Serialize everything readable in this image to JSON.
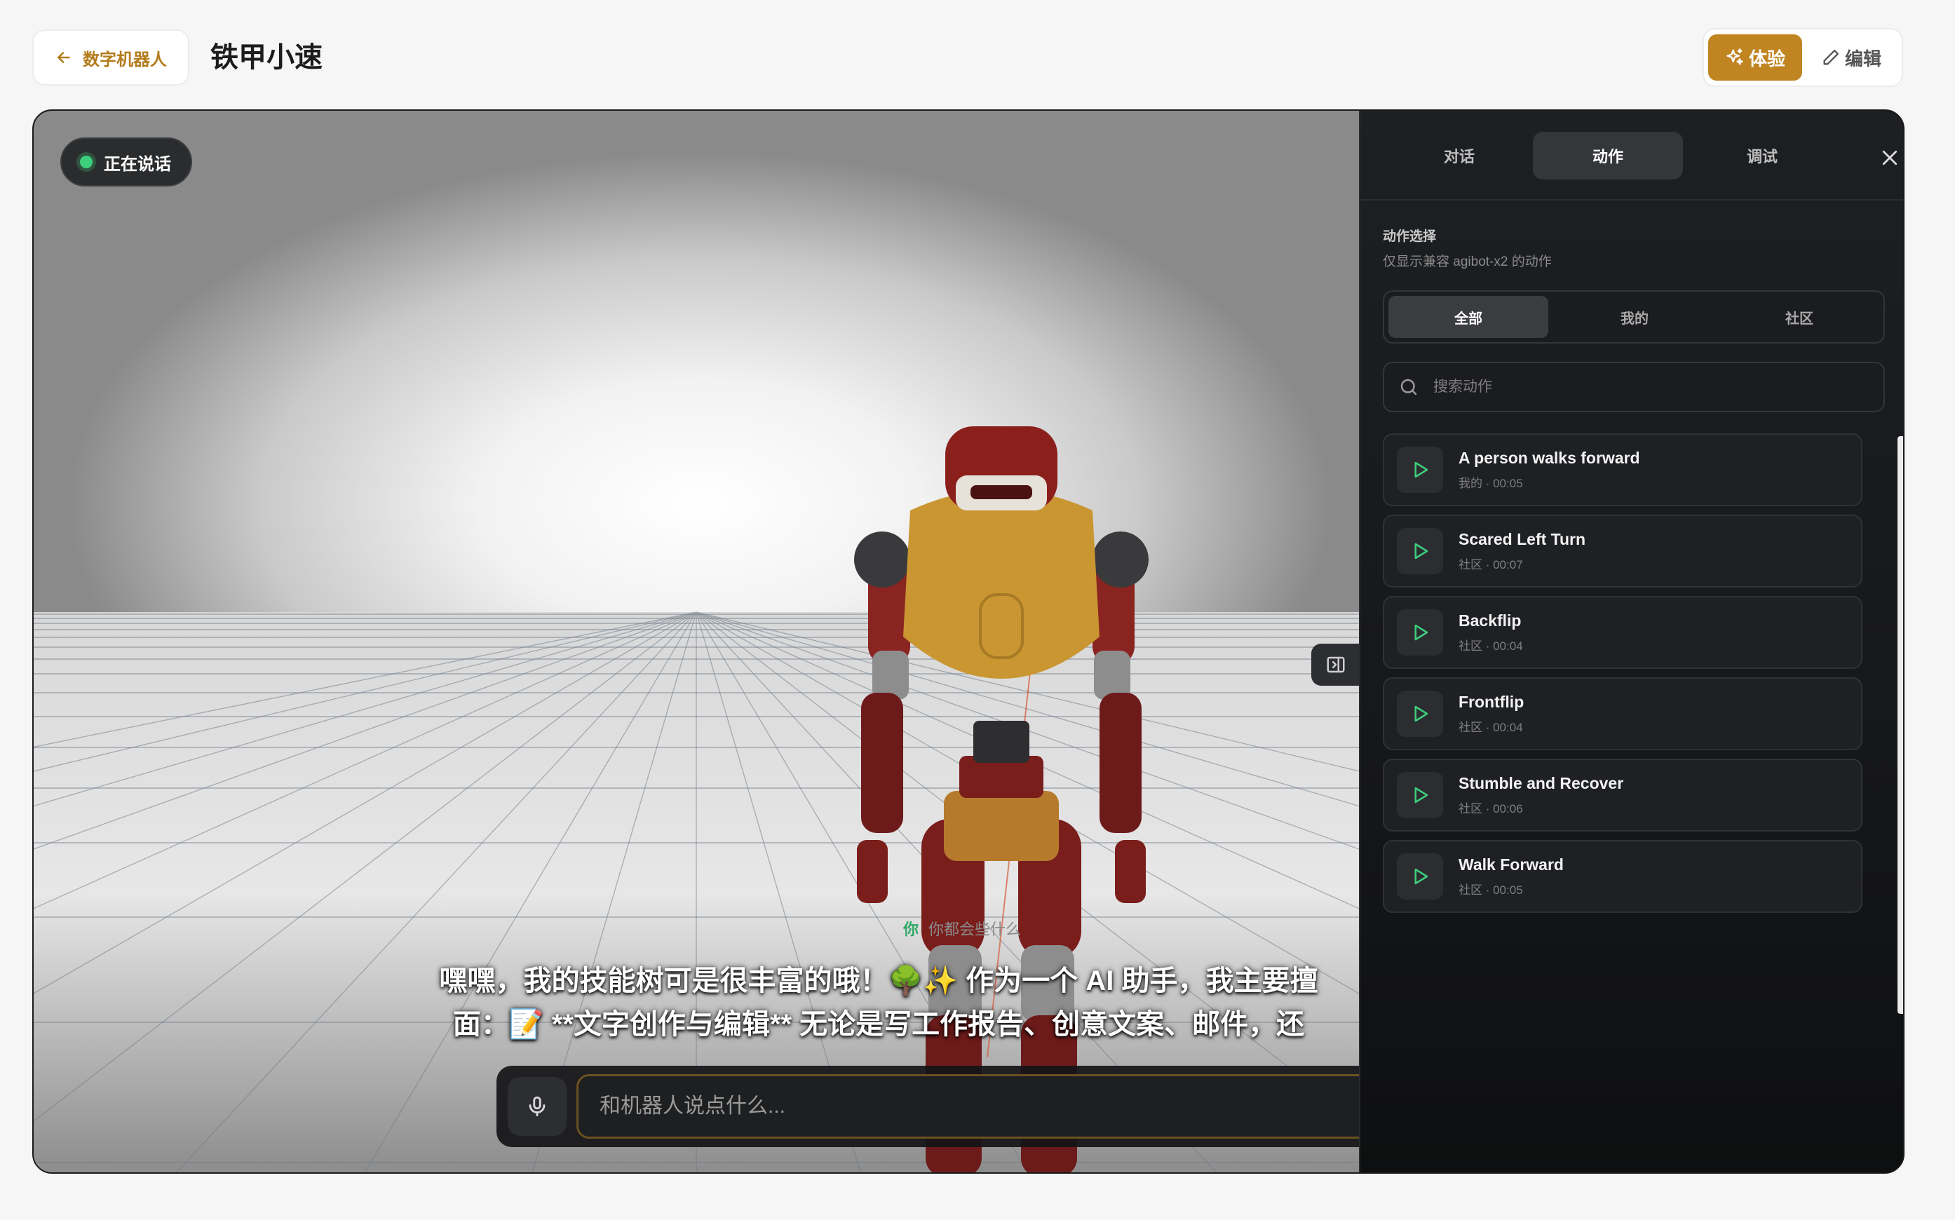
{
  "header": {
    "back_label": "数字机器人",
    "title": "铁甲小速",
    "mode_experience": "体验",
    "mode_edit": "编辑"
  },
  "viewport": {
    "status": "正在说话",
    "user_tag": "你",
    "user_message": "你都会些什么",
    "subtitle_line1": "嘿嘿，我的技能树可是很丰富的哦！🌳✨ 作为一个 AI 助手，我主要擅",
    "subtitle_line2": "面：📝 **文字创作与编辑** 无论是写工作报告、创意文案、邮件，还",
    "input_placeholder": "和机器人说点什么..."
  },
  "panel": {
    "tabs": [
      "对话",
      "动作",
      "调试"
    ],
    "active_tab": "动作",
    "section_title": "动作选择",
    "section_subtitle": "仅显示兼容 agibot-x2 的动作",
    "filters": [
      "全部",
      "我的",
      "社区"
    ],
    "active_filter": "全部",
    "search_placeholder": "搜索动作",
    "motions": [
      {
        "name": "A person walks forward",
        "meta": "我的 · 00:05"
      },
      {
        "name": "Scared Left Turn",
        "meta": "社区 · 00:07"
      },
      {
        "name": "Backflip",
        "meta": "社区 · 00:04"
      },
      {
        "name": "Frontflip",
        "meta": "社区 · 00:04"
      },
      {
        "name": "Stumble and Recover",
        "meta": "社区 · 00:06"
      },
      {
        "name": "Walk Forward",
        "meta": "社区 · 00:05"
      }
    ]
  },
  "colors": {
    "accent": "#c08420",
    "status_green": "#3ecf7c",
    "user_tag_green": "#2fa866"
  }
}
